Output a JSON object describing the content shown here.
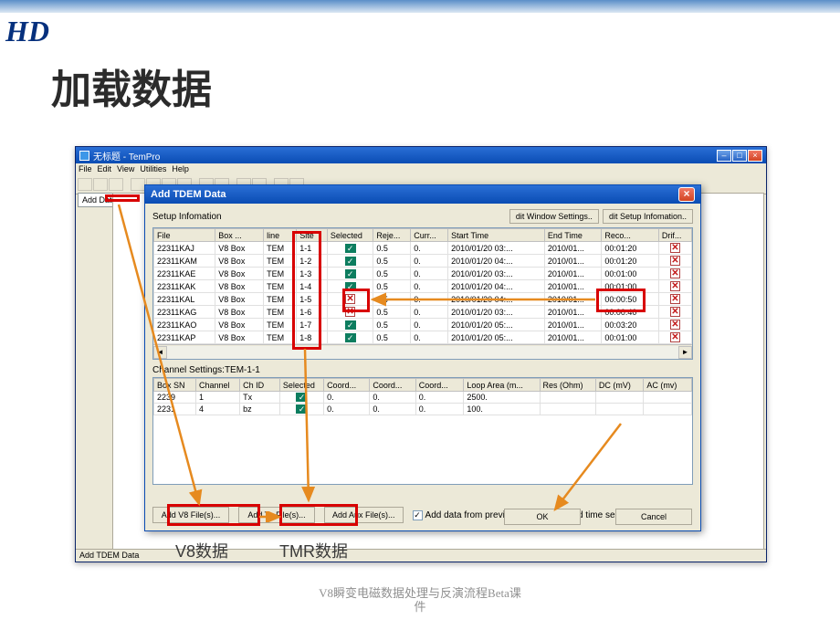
{
  "logo_text": "HD",
  "slide": {
    "title": "加载数据"
  },
  "window": {
    "title": "无标题 - TemPro",
    "menus": [
      "File",
      "Edit",
      "View",
      "Utilities",
      "Help"
    ],
    "left_tab": "Add Data",
    "status": "Add TDEM Data"
  },
  "dialog": {
    "title": "Add TDEM Data",
    "setup_label": "Setup  Infomation",
    "btn_edit_window": "dit Window Settings..",
    "btn_edit_setup": "dit Setup Infomation..",
    "columns": [
      "File",
      "Box ...",
      "line",
      "Site",
      "Selected",
      "Reje...",
      "Curr...",
      "Start Time",
      "End Time",
      "Reco...",
      "Drif..."
    ],
    "rows": [
      {
        "file": "22311KAJ",
        "box": "V8 Box",
        "line": "TEM",
        "site": "1-1",
        "sel": true,
        "seltype": "check",
        "rej": "0.5",
        "cur": "0.",
        "start": "2010/01/20 03:...",
        "end": "2010/01...",
        "rec": "00:01:20",
        "drif": "x"
      },
      {
        "file": "22311KAM",
        "box": "V8 Box",
        "line": "TEM",
        "site": "1-2",
        "sel": true,
        "seltype": "check",
        "rej": "0.5",
        "cur": "0.",
        "start": "2010/01/20 04:...",
        "end": "2010/01...",
        "rec": "00:01:20",
        "drif": "x"
      },
      {
        "file": "22311KAE",
        "box": "V8 Box",
        "line": "TEM",
        "site": "1-3",
        "sel": true,
        "seltype": "check",
        "rej": "0.5",
        "cur": "0.",
        "start": "2010/01/20 03:...",
        "end": "2010/01...",
        "rec": "00:01:00",
        "drif": "x"
      },
      {
        "file": "22311KAK",
        "box": "V8 Box",
        "line": "TEM",
        "site": "1-4",
        "sel": true,
        "seltype": "check",
        "rej": "0.5",
        "cur": "0.",
        "start": "2010/01/20 04:...",
        "end": "2010/01...",
        "rec": "00:01:00",
        "drif": "x"
      },
      {
        "file": "22311KAL",
        "box": "V8 Box",
        "line": "TEM",
        "site": "1-5",
        "sel": false,
        "seltype": "x",
        "rej": "0.5",
        "cur": "0.",
        "start": "2010/01/20 04:...",
        "end": "2010/01...",
        "rec": "00:00:50",
        "drif": "x"
      },
      {
        "file": "22311KAG",
        "box": "V8 Box",
        "line": "TEM",
        "site": "1-6",
        "sel": false,
        "seltype": "x",
        "rej": "0.5",
        "cur": "0.",
        "start": "2010/01/20 03:...",
        "end": "2010/01...",
        "rec": "00:00:40",
        "drif": "x"
      },
      {
        "file": "22311KAO",
        "box": "V8 Box",
        "line": "TEM",
        "site": "1-7",
        "sel": true,
        "seltype": "check",
        "rej": "0.5",
        "cur": "0.",
        "start": "2010/01/20 05:...",
        "end": "2010/01...",
        "rec": "00:03:20",
        "drif": "x"
      },
      {
        "file": "22311KAP",
        "box": "V8 Box",
        "line": "TEM",
        "site": "1-8",
        "sel": true,
        "seltype": "check",
        "rej": "0.5",
        "cur": "0.",
        "start": "2010/01/20 05:...",
        "end": "2010/01...",
        "rec": "00:01:00",
        "drif": "x"
      }
    ],
    "ch_label": "Channel Settings:TEM-1-1",
    "ch_columns": [
      "Box SN",
      "Channel",
      "Ch ID",
      "Selected",
      "Coord...",
      "Coord...",
      "Coord...",
      "Loop Area (m...",
      "Res (Ohm)",
      "DC (mV)",
      "AC (mv)"
    ],
    "ch_rows": [
      {
        "sn": "2239",
        "ch": "1",
        "id": "Tx",
        "sel": true,
        "c1": "0.",
        "c2": "0.",
        "c3": "0.",
        "loop": "2500.",
        "res": "",
        "dc": "",
        "ac": ""
      },
      {
        "sn": "2231",
        "ch": "4",
        "id": "bz",
        "sel": true,
        "c1": "0.",
        "c2": "0.",
        "c3": "0.",
        "loop": "100.",
        "res": "",
        "dc": "",
        "ac": ""
      }
    ],
    "btn_add_v8": "Add  V8 File(s)...",
    "btn_add_tx": "Add Tx File(s)...",
    "btn_add_aux": "Add Aux File(s)...",
    "cb_prev": "Add data from previous folder",
    "cb_time": "Add time series",
    "btn_ok": "OK",
    "btn_cancel": "Cancel"
  },
  "annotations": {
    "v8": "V8数据",
    "tmr": "TMR数据"
  },
  "footer": {
    "line1": "V8瞬变电磁数据处理与反演流程Beta课",
    "line2": "件"
  }
}
